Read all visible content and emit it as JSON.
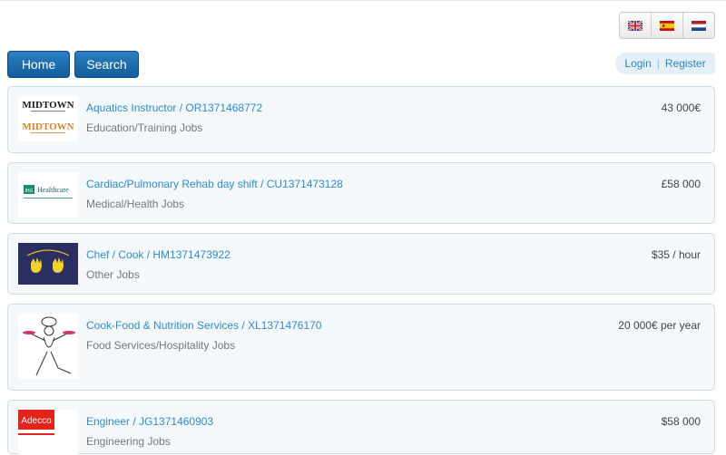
{
  "languages": [
    {
      "code": "en",
      "icon": "uk-flag-icon"
    },
    {
      "code": "es",
      "icon": "spain-flag-icon"
    },
    {
      "code": "nl",
      "icon": "netherlands-flag-icon"
    }
  ],
  "nav": {
    "home_label": "Home",
    "search_label": "Search"
  },
  "auth": {
    "login_label": "Login",
    "separator": "|",
    "register_label": "Register"
  },
  "jobs": [
    {
      "logo_text": "MIDTOWN",
      "title": "Aquatics Instructor / OR1371468772",
      "category": "Education/Training Jobs",
      "salary": "43 000€"
    },
    {
      "logo_text": "Healthcare",
      "title": "Cardiac/Pulmonary Rehab day shift / CU1371473128",
      "category": "Medical/Health Jobs",
      "salary": "£58 000"
    },
    {
      "logo_text": "",
      "title": "Chef / Cook / HM1371473922",
      "category": "Other Jobs",
      "salary": "$35 / hour"
    },
    {
      "logo_text": "",
      "title": "Cook-Food & Nutrition Services / XL1371476170",
      "category": "Food Services/Hospitality Jobs",
      "salary": "20 000€ per year"
    },
    {
      "logo_text": "Adecco",
      "title": "Engineer / JG1371460903",
      "category": "Engineering Jobs",
      "salary": "$58 000"
    }
  ],
  "colors": {
    "link": "#2d8ccf",
    "button": "#1a6aac",
    "card_bg": "#f4f8fb"
  }
}
